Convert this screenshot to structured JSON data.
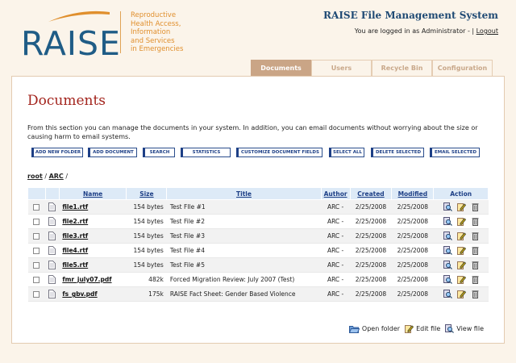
{
  "logo": {
    "word": "RAISE",
    "tagline": [
      "Reproductive",
      "Health Access,",
      "Information",
      "and Services",
      "in Emergencies"
    ]
  },
  "header": {
    "system_title": "RAISE File Management System",
    "login_text": "You are logged in as Administrator - |",
    "logout_label": "Logout"
  },
  "tabs": [
    {
      "label": "Documents",
      "active": true
    },
    {
      "label": "Users",
      "active": false
    },
    {
      "label": "Recycle Bin",
      "active": false
    },
    {
      "label": "Configuration",
      "active": false
    }
  ],
  "main": {
    "title": "Documents",
    "intro": "From this section you can manage the documents in your system. In addition, you can email documents without worrying about the size or causing harm to email systems."
  },
  "toolbar": {
    "add_folder": "ADD NEW FOLDER",
    "add_document": "ADD DOCUMENT",
    "search": "SEARCH",
    "statistics": "STATISTICS",
    "customize": "CUSTOMIZE DOCUMENT FIELDS",
    "select_all": "SELECT ALL",
    "delete_selected": "DELETE SELECTED",
    "email_selected": "EMAIL SELECTED"
  },
  "breadcrumb": {
    "root": "root",
    "sep1": "/",
    "folder": "ARC",
    "sep2": "/"
  },
  "table": {
    "headers": {
      "name": "Name",
      "size": "Size",
      "title": "Title",
      "author": "Author",
      "created": "Created",
      "modified": "Modified",
      "action": "Action"
    },
    "rows": [
      {
        "name": "file1.rtf",
        "size": "154 bytes",
        "title": "Test FIle #1",
        "author": "ARC -",
        "created": "2/25/2008",
        "modified": "2/25/2008"
      },
      {
        "name": "file2.rtf",
        "size": "154 bytes",
        "title": "Test File #2",
        "author": "ARC -",
        "created": "2/25/2008",
        "modified": "2/25/2008"
      },
      {
        "name": "file3.rtf",
        "size": "154 bytes",
        "title": "Test File #3",
        "author": "ARC -",
        "created": "2/25/2008",
        "modified": "2/25/2008"
      },
      {
        "name": "file4.rtf",
        "size": "154 bytes",
        "title": "Test File #4",
        "author": "ARC -",
        "created": "2/25/2008",
        "modified": "2/25/2008"
      },
      {
        "name": "file5.rtf",
        "size": "154 bytes",
        "title": "Test File #5",
        "author": "ARC -",
        "created": "2/25/2008",
        "modified": "2/25/2008"
      },
      {
        "name": "fmr_july07.pdf",
        "size": "482k",
        "title": "Forced Migration Review: July 2007 (Test)",
        "author": "ARC -",
        "created": "2/25/2008",
        "modified": "2/25/2008"
      },
      {
        "name": "fs_gbv.pdf",
        "size": "175k",
        "title": "RAISE Fact Sheet: Gender Based Violence",
        "author": "ARC -",
        "created": "2/25/2008",
        "modified": "2/25/2008"
      }
    ]
  },
  "legend": {
    "open_folder": "Open folder",
    "edit_file": "Edit file",
    "view_file": "View file"
  },
  "colors": {
    "brand_blue": "#1f5c86",
    "brand_orange": "#e08f2d",
    "title_red": "#a3241d",
    "tab_active": "#caa586",
    "header_bg": "#ddeaf7"
  }
}
